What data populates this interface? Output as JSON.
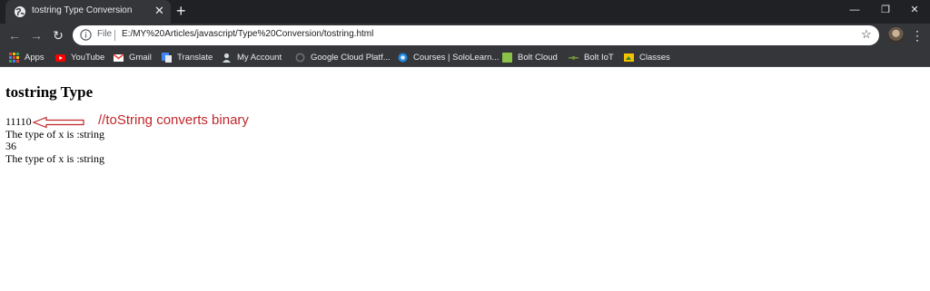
{
  "browser": {
    "tab": {
      "title": "tostring Type Conversion",
      "close": "✕",
      "icon": "globe-icon"
    },
    "new_tab": "+",
    "window_controls": {
      "minimize": "—",
      "restore": "❐",
      "close": "✕"
    },
    "toolbar": {
      "back": "←",
      "forward": "→",
      "reload": "↻",
      "scheme_label": "File",
      "url": "E:/MY%20Articles/javascript/Type%20Conversion/tostring.html",
      "star": "☆",
      "menu": "⋮"
    },
    "bookmarks": [
      {
        "label": "Apps",
        "icon": "apps-grid-icon",
        "color": "#e8eaed"
      },
      {
        "label": "YouTube",
        "icon": "youtube-icon",
        "color": "#ff0000"
      },
      {
        "label": "Gmail",
        "icon": "gmail-icon",
        "color": "#ea4335"
      },
      {
        "label": "Translate",
        "icon": "translate-icon",
        "color": "#4285f4"
      },
      {
        "label": "My Account",
        "icon": "my-account-icon",
        "color": "#cfd8dc"
      },
      {
        "label": "Google Cloud Platf...",
        "icon": "google-cloud-icon",
        "color": "#6d6f73"
      },
      {
        "label": "Courses | SoloLearn...",
        "icon": "sololearn-icon",
        "color": "#1e88e5"
      },
      {
        "label": "Bolt Cloud",
        "icon": "bolt-cloud-icon",
        "color": "#8bc34a"
      },
      {
        "label": "Bolt IoT",
        "icon": "bolt-iot-icon",
        "color": "#6d8f3a"
      },
      {
        "label": "Classes",
        "icon": "classes-icon",
        "color": "#f2c200"
      }
    ]
  },
  "page": {
    "heading": "tostring Type",
    "lines": [
      "11110",
      "The type of x is :string",
      "36",
      "The type of x is :string"
    ],
    "annotation": "//toString converts binary",
    "annotation_color": "#c0282d"
  }
}
